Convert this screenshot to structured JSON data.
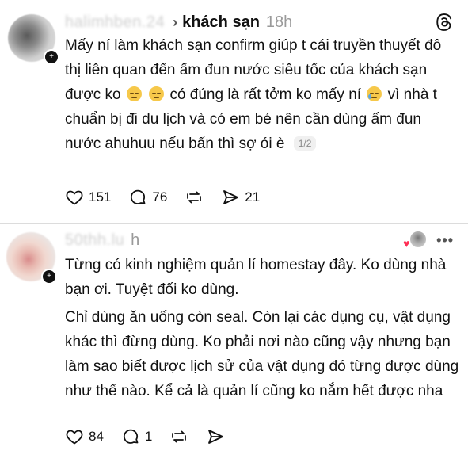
{
  "post1": {
    "username": "halimhben.24",
    "topic": "khách sạn",
    "time": "18h",
    "paragraph_before_e1": "Mấy ní làm khách sạn confirm giúp t cái truyền thuyết đô thị liên quan đến ấm đun nước siêu tốc của khách sạn được ko",
    "paragraph_between_e2": "có đúng  là rất tởm ko mấy ní",
    "paragraph_after_e3": "vì nhà t chuẩn bị đi du lịch và có em bé nên cần dùng ấm đun nước ahuhuu nếu bẩn thì sợ ói è",
    "page_badge": "1/2",
    "likes": "151",
    "comments": "76",
    "shares": "21"
  },
  "post2": {
    "username": "50thh.lu",
    "time": "h",
    "paragraph1": "Từng có kinh nghiệm quản lí homestay đây. Ko dùng nhà bạn ơi. Tuyệt đối ko dùng.",
    "paragraph2": "Chỉ dùng ăn uống còn seal. Còn lại các dụng cụ, vật dụng khác thì đừng dùng. Ko phải nơi nào cũng vậy nhưng bạn làm sao biết được lịch sử của vật dụng đó từng được dùng như thế nào. Kể cả là quản lí cũng ko nắm hết được nha",
    "likes": "84",
    "comments": "1",
    "more_label": "•••"
  },
  "icons": {
    "chevron": "chevron-right-icon",
    "threads": "threads-logo-icon",
    "like": "heart-icon",
    "comment": "comment-bubble-icon",
    "repost": "repost-icon",
    "share": "send-icon",
    "sad_emoji": "pensive-face-emoji",
    "cry_emoji": "crying-face-emoji"
  },
  "colors": {
    "text": "#111111",
    "muted": "#9a9a9a",
    "divider": "#dcdcdc",
    "heart": "#ff2f55"
  }
}
